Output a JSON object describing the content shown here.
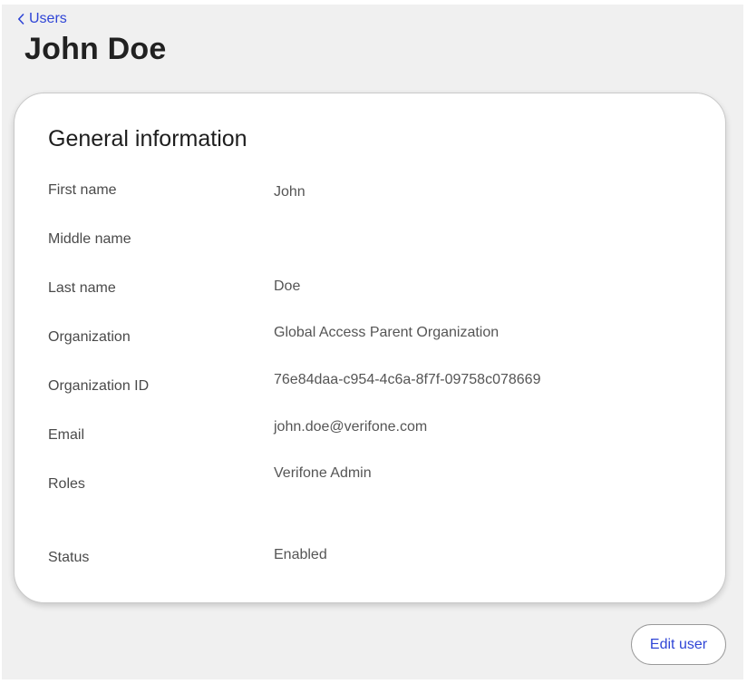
{
  "nav": {
    "back_label": "Users"
  },
  "header": {
    "title": "John Doe"
  },
  "general": {
    "title": "General information",
    "fields": [
      {
        "label": "First name",
        "value": "John"
      },
      {
        "label": "Middle name",
        "value": ""
      },
      {
        "label": "Last name",
        "value": "Doe"
      },
      {
        "label": "Organization",
        "value": "Global Access Parent Organization"
      },
      {
        "label": "Organization ID",
        "value": "76e84daa-c954-4c6a-8f7f-09758c078669"
      },
      {
        "label": "Email",
        "value": "john.doe@verifone.com"
      },
      {
        "label": "Roles",
        "value": "Verifone Admin"
      },
      {
        "label": "Status",
        "value": "Enabled"
      }
    ]
  },
  "actions": {
    "edit_label": "Edit user"
  },
  "colors": {
    "accent": "#2f45d6",
    "background": "#f0f0f0",
    "card": "#ffffff"
  }
}
